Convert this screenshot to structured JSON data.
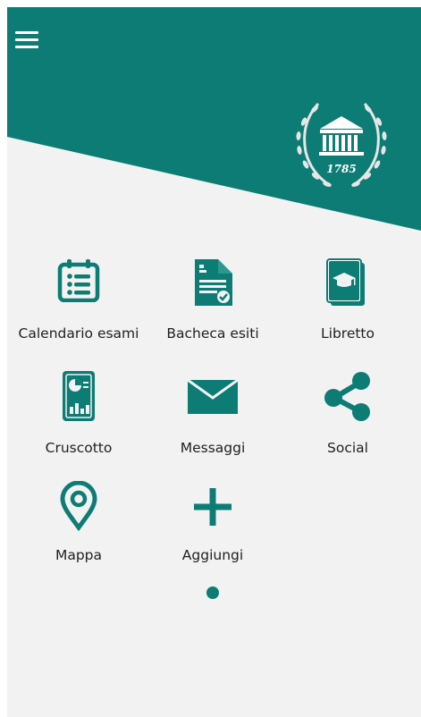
{
  "colors": {
    "accent": "#0d7c74",
    "background": "#f2f2f2",
    "header_icon": "#ffffff"
  },
  "header": {
    "menu_icon": "hamburger-menu-icon",
    "logo_year": "1785"
  },
  "grid": {
    "items": [
      {
        "label": "Calendario esami",
        "icon": "calendar-list-icon"
      },
      {
        "label": "Bacheca esiti",
        "icon": "document-check-icon"
      },
      {
        "label": "Libretto",
        "icon": "graduation-book-icon"
      },
      {
        "label": "Cruscotto",
        "icon": "dashboard-report-icon"
      },
      {
        "label": "Messaggi",
        "icon": "envelope-icon"
      },
      {
        "label": "Social",
        "icon": "share-icon"
      },
      {
        "label": "Mappa",
        "icon": "map-pin-icon"
      },
      {
        "label": "Aggiungi",
        "icon": "plus-icon"
      }
    ]
  },
  "pager": {
    "current_page": 1,
    "total_pages": 1
  }
}
